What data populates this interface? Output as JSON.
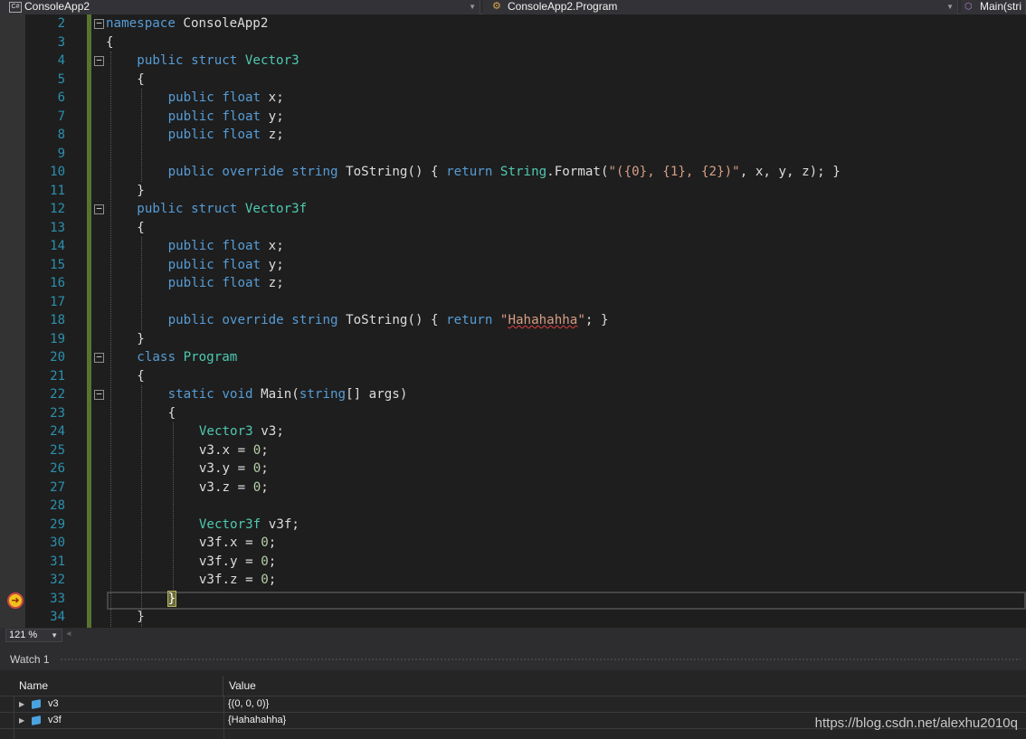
{
  "navbar": {
    "project": "ConsoleApp2",
    "type": "ConsoleApp2.Program",
    "member": "Main(stri"
  },
  "editor": {
    "zoom": "121 %",
    "current_line": 33,
    "lines": [
      {
        "n": "2",
        "indent": 0,
        "fold": true,
        "spans": [
          [
            "kw",
            "namespace"
          ],
          [
            "",
            "ConsoleApp2"
          ]
        ],
        "sep": [
          " "
        ]
      },
      {
        "n": "3",
        "indent": 0,
        "spans": [
          [
            "",
            "{"
          ]
        ]
      },
      {
        "n": "4",
        "indent": 1,
        "fold": true,
        "spans": [
          [
            "kw",
            "public"
          ],
          [
            "kw",
            "struct"
          ],
          [
            "ty",
            "Vector3"
          ]
        ]
      },
      {
        "n": "5",
        "indent": 1,
        "spans": [
          [
            "",
            "{"
          ]
        ]
      },
      {
        "n": "6",
        "indent": 2,
        "spans": [
          [
            "kw",
            "public"
          ],
          [
            "kw",
            "float"
          ],
          [
            "",
            "x;"
          ]
        ]
      },
      {
        "n": "7",
        "indent": 2,
        "spans": [
          [
            "kw",
            "public"
          ],
          [
            "kw",
            "float"
          ],
          [
            "",
            "y;"
          ]
        ]
      },
      {
        "n": "8",
        "indent": 2,
        "spans": [
          [
            "kw",
            "public"
          ],
          [
            "kw",
            "float"
          ],
          [
            "",
            "z;"
          ]
        ]
      },
      {
        "n": "9",
        "indent": 2,
        "spans": []
      },
      {
        "n": "10",
        "indent": 2,
        "raw": [
          [
            "kw",
            "public"
          ],
          [
            "",
            " "
          ],
          [
            "kw",
            "override"
          ],
          [
            "",
            " "
          ],
          [
            "kw",
            "string"
          ],
          [
            "",
            " ToString() { "
          ],
          [
            "kw",
            "return"
          ],
          [
            "",
            " "
          ],
          [
            "ty",
            "String"
          ],
          [
            "",
            ".Format("
          ],
          [
            "st",
            "\"({0}, {1}, {2})\""
          ],
          [
            "",
            ", x, y, z); }"
          ]
        ]
      },
      {
        "n": "11",
        "indent": 1,
        "spans": [
          [
            "",
            "}"
          ]
        ]
      },
      {
        "n": "12",
        "indent": 1,
        "fold": true,
        "spans": [
          [
            "kw",
            "public"
          ],
          [
            "kw",
            "struct"
          ],
          [
            "ty",
            "Vector3f"
          ]
        ]
      },
      {
        "n": "13",
        "indent": 1,
        "spans": [
          [
            "",
            "{"
          ]
        ]
      },
      {
        "n": "14",
        "indent": 2,
        "spans": [
          [
            "kw",
            "public"
          ],
          [
            "kw",
            "float"
          ],
          [
            "",
            "x;"
          ]
        ]
      },
      {
        "n": "15",
        "indent": 2,
        "spans": [
          [
            "kw",
            "public"
          ],
          [
            "kw",
            "float"
          ],
          [
            "",
            "y;"
          ]
        ]
      },
      {
        "n": "16",
        "indent": 2,
        "spans": [
          [
            "kw",
            "public"
          ],
          [
            "kw",
            "float"
          ],
          [
            "",
            "z;"
          ]
        ]
      },
      {
        "n": "17",
        "indent": 2,
        "spans": []
      },
      {
        "n": "18",
        "indent": 2,
        "raw": [
          [
            "kw",
            "public"
          ],
          [
            "",
            " "
          ],
          [
            "kw",
            "override"
          ],
          [
            "",
            " "
          ],
          [
            "kw",
            "string"
          ],
          [
            "",
            " ToString() { "
          ],
          [
            "kw",
            "return"
          ],
          [
            "",
            " "
          ],
          [
            "st",
            "\""
          ],
          [
            "st squiggle",
            "Hahahahha"
          ],
          [
            "st",
            "\""
          ],
          [
            "",
            "; }"
          ]
        ]
      },
      {
        "n": "19",
        "indent": 1,
        "spans": [
          [
            "",
            "}"
          ]
        ]
      },
      {
        "n": "20",
        "indent": 1,
        "fold": true,
        "spans": [
          [
            "kw",
            "class"
          ],
          [
            "ty",
            "Program"
          ]
        ]
      },
      {
        "n": "21",
        "indent": 1,
        "spans": [
          [
            "",
            "{"
          ]
        ]
      },
      {
        "n": "22",
        "indent": 2,
        "fold": true,
        "raw": [
          [
            "kw",
            "static"
          ],
          [
            "",
            " "
          ],
          [
            "kw",
            "void"
          ],
          [
            "",
            " Main("
          ],
          [
            "kw",
            "string"
          ],
          [
            "",
            "[] args)"
          ]
        ]
      },
      {
        "n": "23",
        "indent": 2,
        "spans": [
          [
            "",
            "{"
          ]
        ]
      },
      {
        "n": "24",
        "indent": 3,
        "spans": [
          [
            "ty",
            "Vector3"
          ],
          [
            "",
            "v3;"
          ]
        ]
      },
      {
        "n": "25",
        "indent": 3,
        "raw": [
          [
            "",
            "v3.x = "
          ],
          [
            "nu",
            "0"
          ],
          [
            "",
            ";"
          ]
        ]
      },
      {
        "n": "26",
        "indent": 3,
        "raw": [
          [
            "",
            "v3.y = "
          ],
          [
            "nu",
            "0"
          ],
          [
            "",
            ";"
          ]
        ]
      },
      {
        "n": "27",
        "indent": 3,
        "raw": [
          [
            "",
            "v3.z = "
          ],
          [
            "nu",
            "0"
          ],
          [
            "",
            ";"
          ]
        ]
      },
      {
        "n": "28",
        "indent": 3,
        "spans": []
      },
      {
        "n": "29",
        "indent": 3,
        "spans": [
          [
            "ty",
            "Vector3f"
          ],
          [
            "",
            "v3f;"
          ]
        ]
      },
      {
        "n": "30",
        "indent": 3,
        "raw": [
          [
            "",
            "v3f.x = "
          ],
          [
            "nu",
            "0"
          ],
          [
            "",
            ";"
          ]
        ]
      },
      {
        "n": "31",
        "indent": 3,
        "raw": [
          [
            "",
            "v3f.y = "
          ],
          [
            "nu",
            "0"
          ],
          [
            "",
            ";"
          ]
        ]
      },
      {
        "n": "32",
        "indent": 3,
        "raw": [
          [
            "",
            "v3f.z = "
          ],
          [
            "nu",
            "0"
          ],
          [
            "",
            ";"
          ]
        ]
      },
      {
        "n": "33",
        "indent": 2,
        "brace": "}"
      },
      {
        "n": "34",
        "indent": 1,
        "spans": [
          [
            "",
            "}"
          ]
        ]
      }
    ]
  },
  "watch": {
    "title": "Watch 1",
    "col_name": "Name",
    "col_value": "Value",
    "rows": [
      {
        "name": "v3",
        "value": "{(0, 0, 0)}"
      },
      {
        "name": "v3f",
        "value": "{Hahahahha}"
      }
    ]
  },
  "watermark": "https://blog.csdn.net/alexhu2010q",
  "colors": {
    "keyword": "#569cd6",
    "type": "#4ec9b0",
    "string": "#d69d85",
    "number": "#b5cea8",
    "line_number": "#2b91af",
    "change_bar": "#577430"
  }
}
